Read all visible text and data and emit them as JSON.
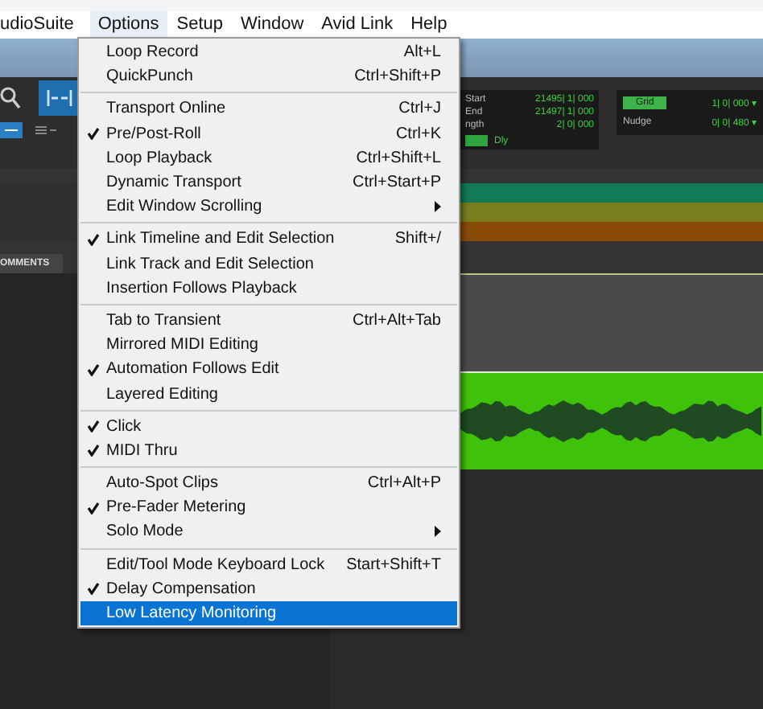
{
  "menubar": [
    {
      "label": "udioSuite",
      "selected": false
    },
    {
      "label": "Options",
      "selected": true
    },
    {
      "label": "Setup",
      "selected": false
    },
    {
      "label": "Window",
      "selected": false
    },
    {
      "label": "Avid Link",
      "selected": false
    },
    {
      "label": "Help",
      "selected": false
    }
  ],
  "counter": {
    "rows": [
      {
        "label": "Start",
        "value": "21495| 1| 000"
      },
      {
        "label": "End",
        "value": "21497| 1| 000"
      },
      {
        "label": "ngth",
        "value": "2| 0| 000"
      }
    ],
    "delay_label": "Dly"
  },
  "grid": {
    "grid_label": "Grid",
    "grid_value": "1| 0| 000 ▾",
    "nudge_label": "Nudge",
    "nudge_value": "0| 0| 480 ▾"
  },
  "tracks": [
    {
      "color": "#127a55"
    },
    {
      "color": "#7a7d1c"
    },
    {
      "color": "#8a4a07"
    }
  ],
  "comments_header": "OMMENTS",
  "menu": [
    [
      {
        "label": "Loop Record",
        "shortcut": "Alt+L",
        "checked": false,
        "submenu": false,
        "selected": false
      },
      {
        "label": "QuickPunch",
        "shortcut": "Ctrl+Shift+P",
        "checked": false,
        "submenu": false,
        "selected": false
      }
    ],
    [
      {
        "label": "Transport Online",
        "shortcut": "Ctrl+J",
        "checked": false,
        "submenu": false,
        "selected": false
      },
      {
        "label": "Pre/Post-Roll",
        "shortcut": "Ctrl+K",
        "checked": true,
        "submenu": false,
        "selected": false
      },
      {
        "label": "Loop Playback",
        "shortcut": "Ctrl+Shift+L",
        "checked": false,
        "submenu": false,
        "selected": false
      },
      {
        "label": "Dynamic Transport",
        "shortcut": "Ctrl+Start+P",
        "checked": false,
        "submenu": false,
        "selected": false
      },
      {
        "label": "Edit Window Scrolling",
        "checked": false,
        "submenu": true,
        "selected": false
      }
    ],
    [
      {
        "label": "Link Timeline and Edit Selection",
        "shortcut": "Shift+/",
        "checked": true,
        "submenu": false,
        "selected": false
      },
      {
        "label": "Link Track and Edit Selection",
        "checked": false,
        "submenu": false,
        "selected": false
      },
      {
        "label": "Insertion Follows Playback",
        "checked": false,
        "submenu": false,
        "selected": false
      }
    ],
    [
      {
        "label": "Tab to Transient",
        "shortcut": "Ctrl+Alt+Tab",
        "checked": false,
        "submenu": false,
        "selected": false
      },
      {
        "label": "Mirrored MIDI Editing",
        "checked": false,
        "submenu": false,
        "selected": false
      },
      {
        "label": "Automation Follows Edit",
        "checked": true,
        "submenu": false,
        "selected": false
      },
      {
        "label": "Layered Editing",
        "checked": false,
        "submenu": false,
        "selected": false
      }
    ],
    [
      {
        "label": "Click",
        "checked": true,
        "submenu": false,
        "selected": false
      },
      {
        "label": "MIDI Thru",
        "checked": true,
        "submenu": false,
        "selected": false
      }
    ],
    [
      {
        "label": "Auto-Spot Clips",
        "shortcut": "Ctrl+Alt+P",
        "checked": false,
        "submenu": false,
        "selected": false
      },
      {
        "label": "Pre-Fader Metering",
        "checked": true,
        "submenu": false,
        "selected": false
      },
      {
        "label": "Solo Mode",
        "checked": false,
        "submenu": true,
        "selected": false
      }
    ],
    [
      {
        "label": "Edit/Tool Mode Keyboard Lock",
        "shortcut": "Start+Shift+T",
        "checked": false,
        "submenu": false,
        "selected": false
      },
      {
        "label": "Delay Compensation",
        "checked": true,
        "submenu": false,
        "selected": false
      },
      {
        "label": "Low Latency Monitoring",
        "checked": false,
        "submenu": false,
        "selected": true
      }
    ]
  ]
}
